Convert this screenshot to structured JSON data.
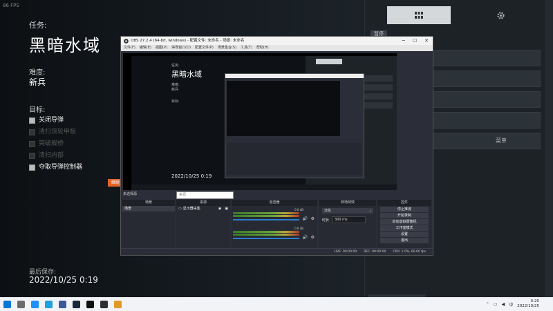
{
  "hud": {
    "fps": "86 FPS",
    "mission_label": "任务:",
    "mission_title": "黑暗水域",
    "difficulty_label": "难度:",
    "difficulty_value": "新兵",
    "objectives_label": "目标:",
    "objectives": [
      {
        "label": "关闭导弹",
        "state": "on"
      },
      {
        "label": "清扫货轮甲板",
        "state": "dim"
      },
      {
        "label": "突破舰桥",
        "state": "dim"
      },
      {
        "label": "清扫内部",
        "state": "dim"
      },
      {
        "label": "夺取导弹控制器",
        "state": "on"
      }
    ],
    "last_save_label": "最后保存:",
    "last_save_value": "2022/10/25 0:19"
  },
  "right_panel": {
    "small_label": "暂停",
    "grid_icon": "grid-icon",
    "gear_icon": "gear-icon",
    "menu_fragment": "菜单"
  },
  "orange_tag": "继续",
  "obs": {
    "title": "OBS 27.2.4 (64-bit, windows) - 配置文件: 未命名 - 场景: 未命名",
    "menu": [
      "文件(F)",
      "编辑(E)",
      "视图(V)",
      "停靠窗口(D)",
      "配置文件(P)",
      "场景集合(S)",
      "工具(T)",
      "帮助(H)"
    ],
    "preview": {
      "mission_label": "任务:",
      "mission_title": "黑暗水域",
      "difficulty_label": "难度:",
      "difficulty_value": "新兵",
      "objectives_label": "目标:",
      "date": "2022/10/25 0:19"
    },
    "no_source_label": "未选择源",
    "properties_placeholder": "来源",
    "docks": {
      "scenes": {
        "header": "场景",
        "items": [
          "场景"
        ]
      },
      "sources": {
        "header": "来源",
        "items": [
          "显示器采集"
        ]
      },
      "mixer": {
        "header": "混音器",
        "channels": [
          {
            "db": "0.0 dB"
          },
          {
            "db": "0.0 dB"
          }
        ]
      },
      "transitions": {
        "header": "转场特效",
        "fade": "淡化",
        "duration_label": "时长",
        "duration_value": "300 ms"
      },
      "controls": {
        "header": "控件",
        "buttons": [
          "停止推流",
          "开始录制",
          "启动虚拟摄像机",
          "工作室模式",
          "设置",
          "退出"
        ]
      }
    },
    "status": {
      "live": "LIVE: 00:00:00",
      "rec": "REC: 00:00:00",
      "cpu": "CPU: 1.0%, 60.00 fps"
    }
  },
  "taskbar": {
    "time": "0:20",
    "date": "2022/10/25",
    "lang": "中",
    "tray": [
      "chevron-up-icon",
      "network-icon",
      "volume-icon"
    ],
    "apps": [
      {
        "name": "windows-start-icon",
        "color": "#0078d4"
      },
      {
        "name": "task-view-icon",
        "color": "#6b6b6b"
      },
      {
        "name": "cortana-icon",
        "color": "#1e90ff"
      },
      {
        "name": "edge-icon",
        "color": "#1fa0e0"
      },
      {
        "name": "store-icon",
        "color": "#3b5998"
      },
      {
        "name": "steam-icon",
        "color": "#1b2838"
      },
      {
        "name": "game-launcher-icon",
        "color": "#111111"
      },
      {
        "name": "obs-icon",
        "color": "#302e31"
      },
      {
        "name": "folder-icon",
        "color": "#e09a2a"
      }
    ]
  }
}
